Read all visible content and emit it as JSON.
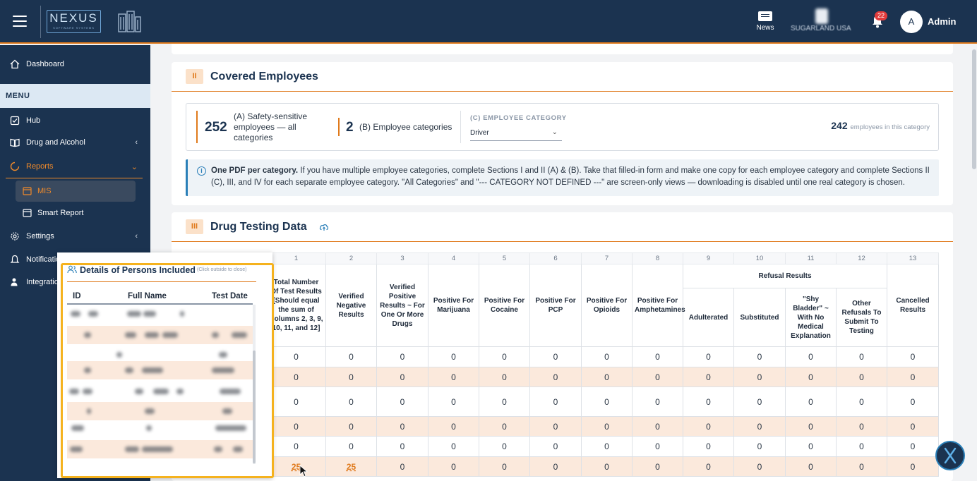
{
  "header": {
    "logo_text": "NEXUS",
    "logo_sub": "SOFTWARE SYSTEMS",
    "news_label": "News",
    "company_label": "SUGARLAND USA",
    "notification_count": "22",
    "avatar_initial": "A",
    "user_name": "Admin"
  },
  "sidebar": {
    "dashboard": "Dashboard",
    "menu_header": "MENU",
    "hub": "Hub",
    "drug_alcohol": "Drug and Alcohol",
    "reports": "Reports",
    "mis": "MIS",
    "smart_report": "Smart Report",
    "settings": "Settings",
    "notifications": "Notifications",
    "integrations": "Integrations"
  },
  "section2": {
    "badge": "II",
    "title": "Covered Employees",
    "a_value": "252",
    "a_label": "(A) Safety-sensitive employees — all categories",
    "b_value": "2",
    "b_label": "(B) Employee categories",
    "c_label": "(C) EMPLOYEE CATEGORY",
    "c_selected": "Driver",
    "emp_count": "242",
    "emp_count_label": "employees in this category",
    "info_bold": "One PDF per category.",
    "info_text": " If you have multiple employee categories, complete Sections I and II (A) & (B). Take that filled-in form and make one copy for each employee category and complete Sections II (C), III, and IV for each separate employee category. \"All Categories\" and \"--- CATEGORY NOT DEFINED ---\" are screen-only views — downloading is disabled until one real category is chosen."
  },
  "section3": {
    "badge": "III",
    "title": "Drug Testing Data",
    "col_numbers": [
      "1",
      "2",
      "3",
      "4",
      "5",
      "6",
      "7",
      "8",
      "9",
      "10",
      "11",
      "12",
      "13"
    ],
    "refusal_group": "Refusal Results",
    "columns": [
      "Total Number Of Test Results [Should equal the sum of Columns 2, 3, 9, 10, 11, and 12]",
      "Verified Negative Results",
      "Verified Positive Results ~ For One Or More Drugs",
      "Positive For Marijuana",
      "Positive For Cocaine",
      "Positive For PCP",
      "Positive For Opioids",
      "Positive For Amphetamines",
      "Adulterated",
      "Substituted",
      "\"Shy Bladder\" ~ With No Medical Explanation",
      "Other Refusals To Submit To Testing",
      "Cancelled Results"
    ],
    "rows": [
      [
        "0",
        "0",
        "0",
        "0",
        "0",
        "0",
        "0",
        "0",
        "0",
        "0",
        "0",
        "0",
        "0"
      ],
      [
        "0",
        "0",
        "0",
        "0",
        "0",
        "0",
        "0",
        "0",
        "0",
        "0",
        "0",
        "0",
        "0"
      ],
      [
        "0",
        "0",
        "0",
        "0",
        "0",
        "0",
        "0",
        "0",
        "0",
        "0",
        "0",
        "0",
        "0"
      ],
      [
        "0",
        "0",
        "0",
        "0",
        "0",
        "0",
        "0",
        "0",
        "0",
        "0",
        "0",
        "0",
        "0"
      ],
      [
        "0",
        "0",
        "0",
        "0",
        "0",
        "0",
        "0",
        "0",
        "0",
        "0",
        "0",
        "0",
        "0"
      ],
      [
        "25",
        "25",
        "0",
        "0",
        "0",
        "0",
        "0",
        "0",
        "0",
        "0",
        "0",
        "0",
        "0"
      ]
    ]
  },
  "popup": {
    "title": "Details of Persons Included",
    "hint": "(Click outside to close)",
    "col_id": "ID",
    "col_name": "Full Name",
    "col_date": "Test Date"
  },
  "colors": {
    "navy": "#1b3350",
    "accent": "#e07a1c",
    "highlight": "#f5b21e",
    "row_alt": "#fbe9dc"
  }
}
